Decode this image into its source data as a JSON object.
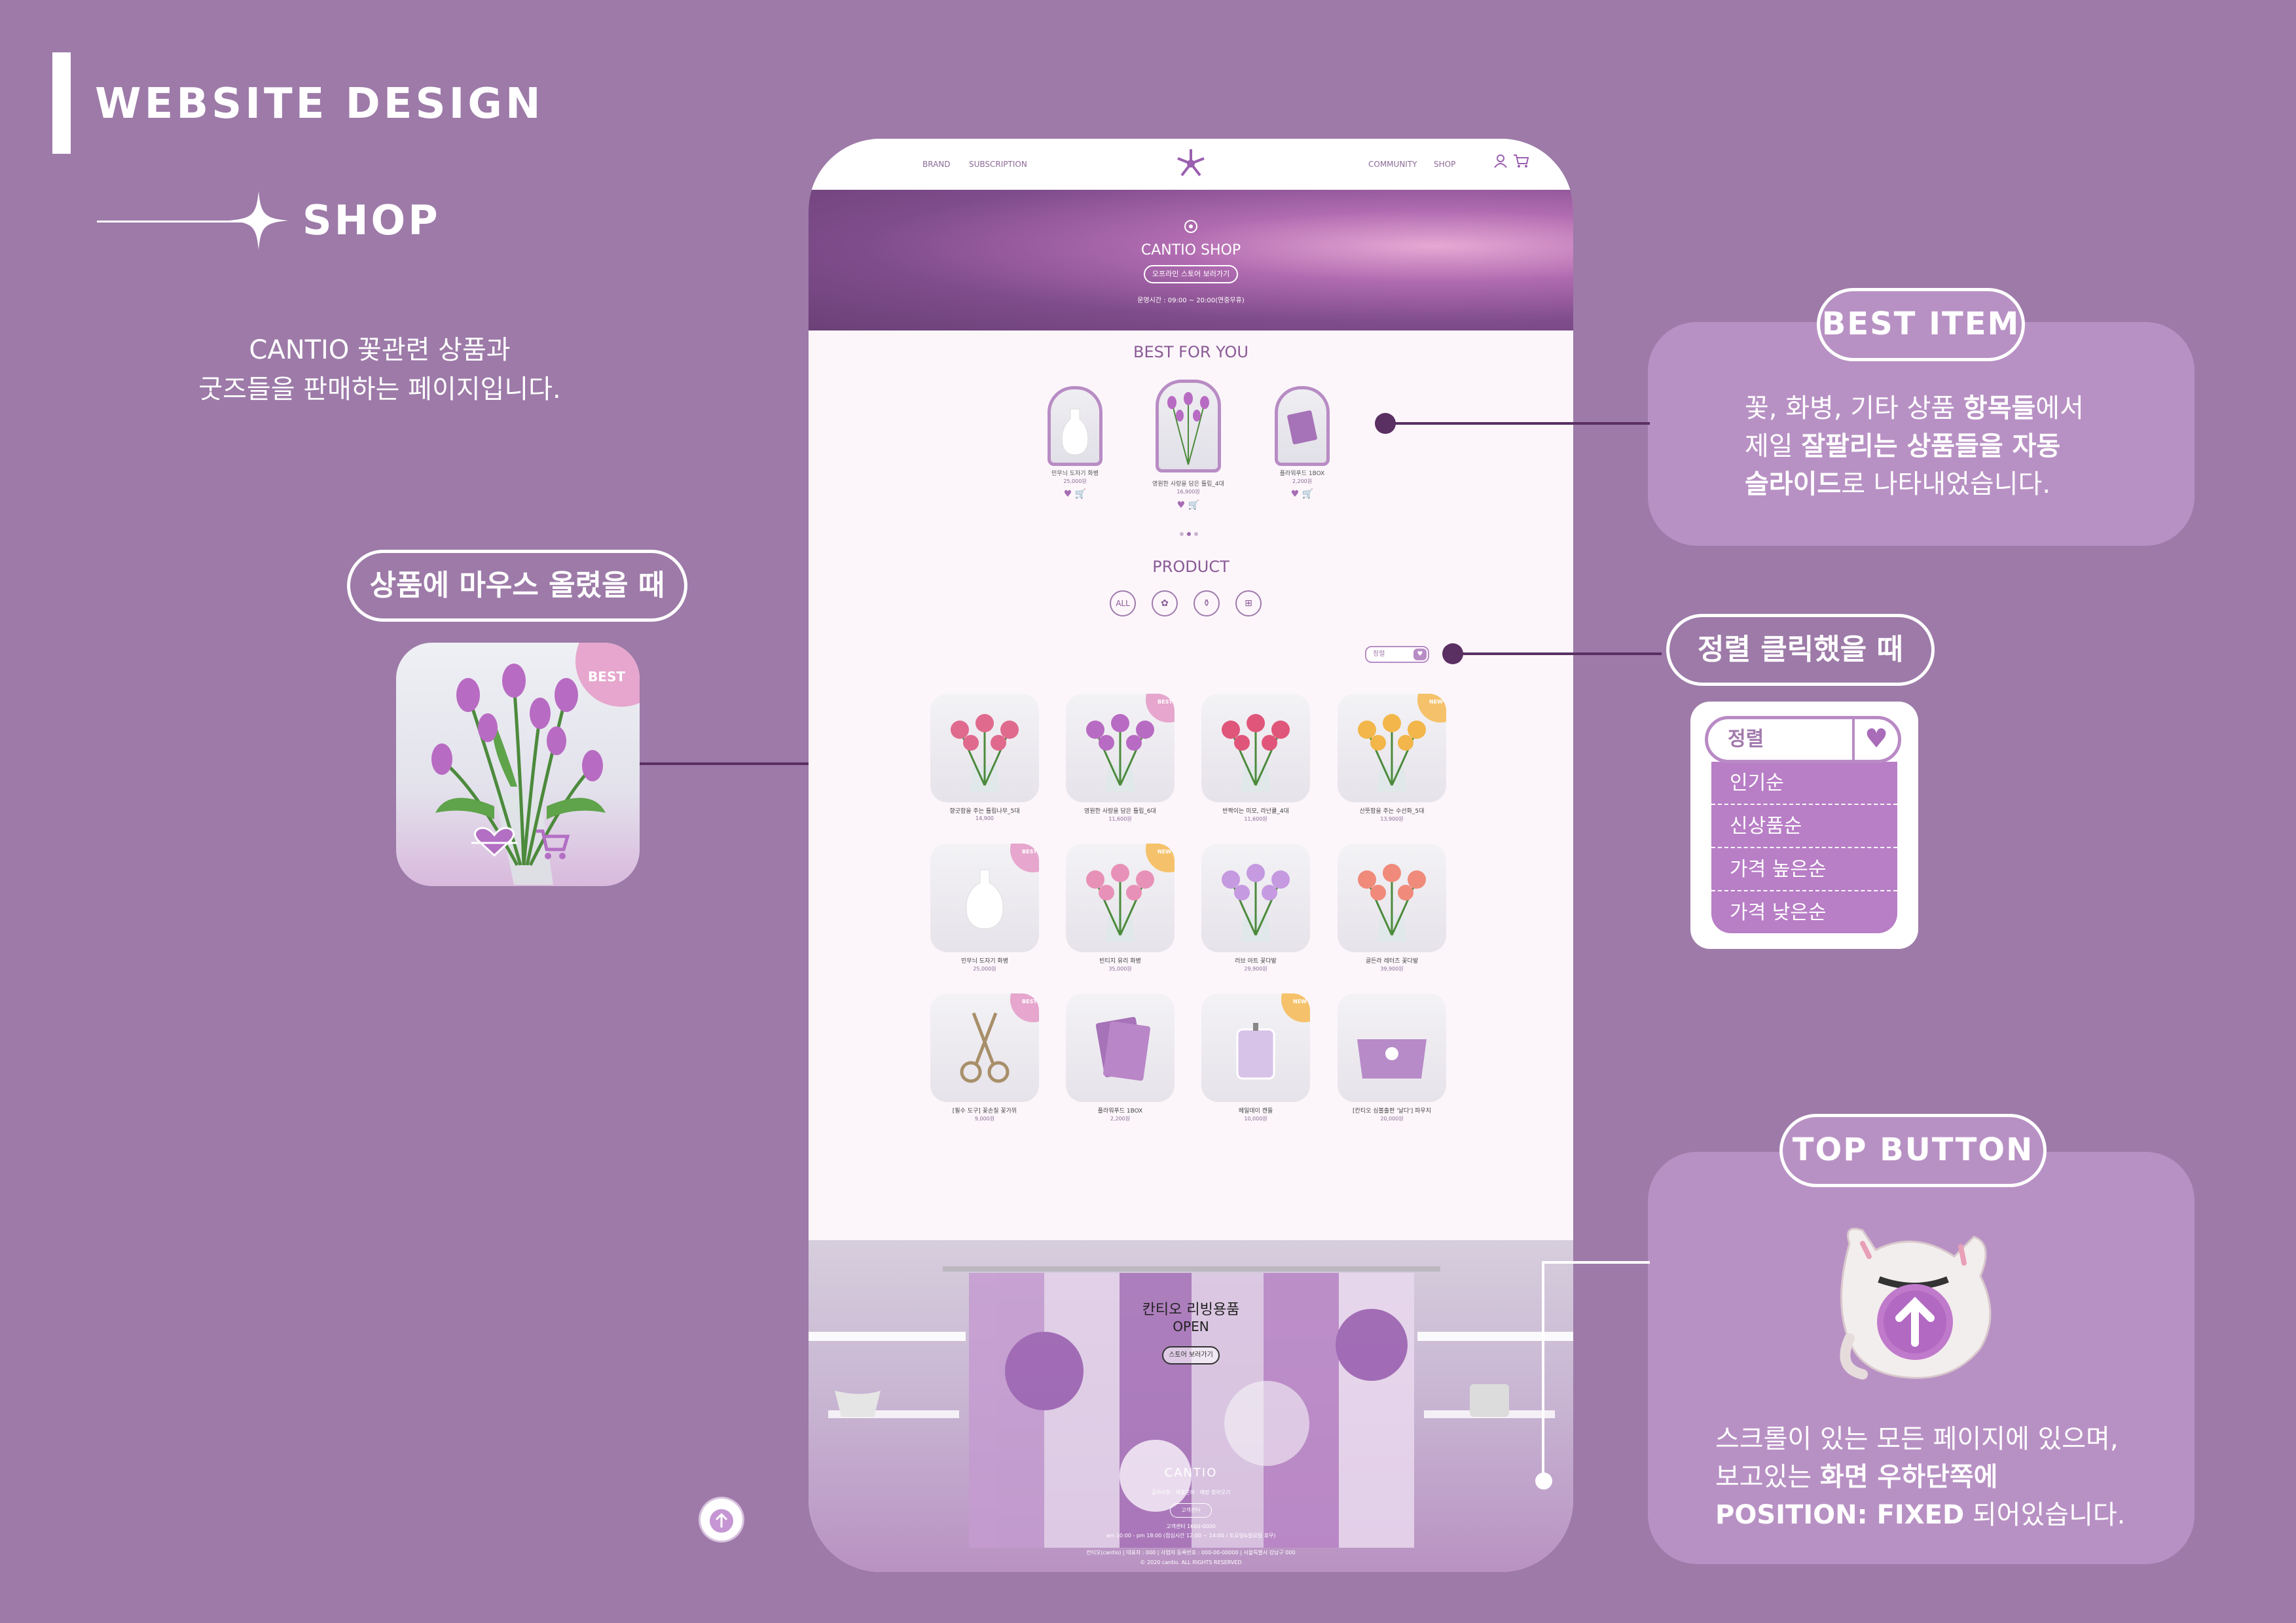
{
  "left": {
    "heading": "WEBSITE DESIGN",
    "subheading": "SHOP",
    "intro_line1": "CANTIO 꽃관련 상품과",
    "intro_line2": "굿즈들을 판매하는 페이지입니다.",
    "hover_label": "상품에 마우스 올렸을 때",
    "hover_badge": "BEST"
  },
  "site": {
    "nav_left": [
      "BRAND",
      "SUBSCRIPTION"
    ],
    "nav_right": [
      "COMMUNITY",
      "SHOP"
    ],
    "hero_title": "CANTIO SHOP",
    "hero_button": "오프라인 스토어 보러가기",
    "hero_hours": "운영시간 : 09:00 ~ 20:00(연중무휴)",
    "best_title": "BEST FOR YOU",
    "best_items": [
      {
        "name": "민무늬 도자기 화병",
        "price": "25,000원"
      },
      {
        "name": "영원한 사랑을 담은 튤립_4대",
        "price": "16,900원"
      },
      {
        "name": "플라워푸드 1BOX",
        "price": "2,200원"
      }
    ],
    "product_title": "PRODUCT",
    "categories": [
      "ALL",
      "flower",
      "vase",
      "gift"
    ],
    "sort_label": "정렬",
    "products": [
      {
        "name": "향긋함을 주는 튤립나무_5대",
        "price": "14,900",
        "badge": ""
      },
      {
        "name": "영원한 사랑을 담은 튤립_6대",
        "price": "11,600원",
        "badge": "BEST"
      },
      {
        "name": "반짝이는 미모, 라넌큘_4대",
        "price": "11,600원",
        "badge": ""
      },
      {
        "name": "산뜻함을 주는 수선화_5대",
        "price": "13,900원",
        "badge": "NEW"
      },
      {
        "name": "민무늬 도자기 화병",
        "price": "25,000원",
        "badge": "BEST"
      },
      {
        "name": "빈티지 유리 화병",
        "price": "35,000원",
        "badge": "NEW"
      },
      {
        "name": "러브 아트 꽃다발",
        "price": "29,900원",
        "badge": ""
      },
      {
        "name": "골든라 레터즈 꽃다발",
        "price": "39,900원",
        "badge": ""
      },
      {
        "name": "[필수 도구] 꽃손질 꽃가위",
        "price": "9,000원",
        "badge": "BEST"
      },
      {
        "name": "플라워푸드 1BOX",
        "price": "2,200원",
        "badge": ""
      },
      {
        "name": "헤일데이 캔들",
        "price": "10,000원",
        "badge": "NEW"
      },
      {
        "name": "[칸티오 심볼출판 '날다'] 파우치",
        "price": "20,000원",
        "badge": ""
      }
    ],
    "banner_title": "칸티오 리빙용품",
    "banner_open": "OPEN",
    "banner_button": "스토어 보러가기",
    "footer_brand": "CANTIO",
    "footer_links": "공지사항  ·  제휴문의  ·  매장 찾아오기",
    "footer_button": "고객센터",
    "footer_contact": "고객센터 1660-0000",
    "footer_hours": "am 10:00 - pm 18:00 (점심시간 12:00 ~ 14:00 / 토요일&일요일 휴무)",
    "footer_info": "칸티오(cantio)  |  대표자 : 000  |  사업자 등록번호 : 000-00-00000  |  서울특별시 강남구 000",
    "footer_copy": "© 2020 cantio. ALL RIGHTS RESERVED"
  },
  "right": {
    "best_label": "BEST ITEM",
    "best_desc_1a": "꽃, 화병, 기타 상품 ",
    "best_desc_1b": "항목들",
    "best_desc_1c": "에서",
    "best_desc_2a": "제일 ",
    "best_desc_2b": "잘팔리는 상품들을 자동",
    "best_desc_3a": "슬라이드",
    "best_desc_3b": "로 나타내었습니다.",
    "sort_label": "정렬 클릭했을 때",
    "sort_select": "정렬",
    "sort_options": [
      "인기순",
      "신상품순",
      "가격 높은순",
      "가격 낮은순"
    ],
    "top_label": "TOP BUTTON",
    "top_desc_1": "스크롤이 있는 모든 페이지에 있으며,",
    "top_desc_2a": "보고있는 ",
    "top_desc_2b": "화면 우하단쪽에",
    "top_desc_3a": "POSITION: FIXED",
    "top_desc_3b": " 되어있습니다."
  },
  "colors": {
    "background": "#9d7aa8",
    "accent": "#b891c4",
    "line": "#5a2f62",
    "badge_best": "#e6a6cd",
    "badge_new": "#f5c26b"
  },
  "icons": [
    "sparkle-icon",
    "logo-flower-icon",
    "user-icon",
    "cart-icon",
    "heart-icon",
    "arrow-up-icon",
    "cat-icon"
  ]
}
